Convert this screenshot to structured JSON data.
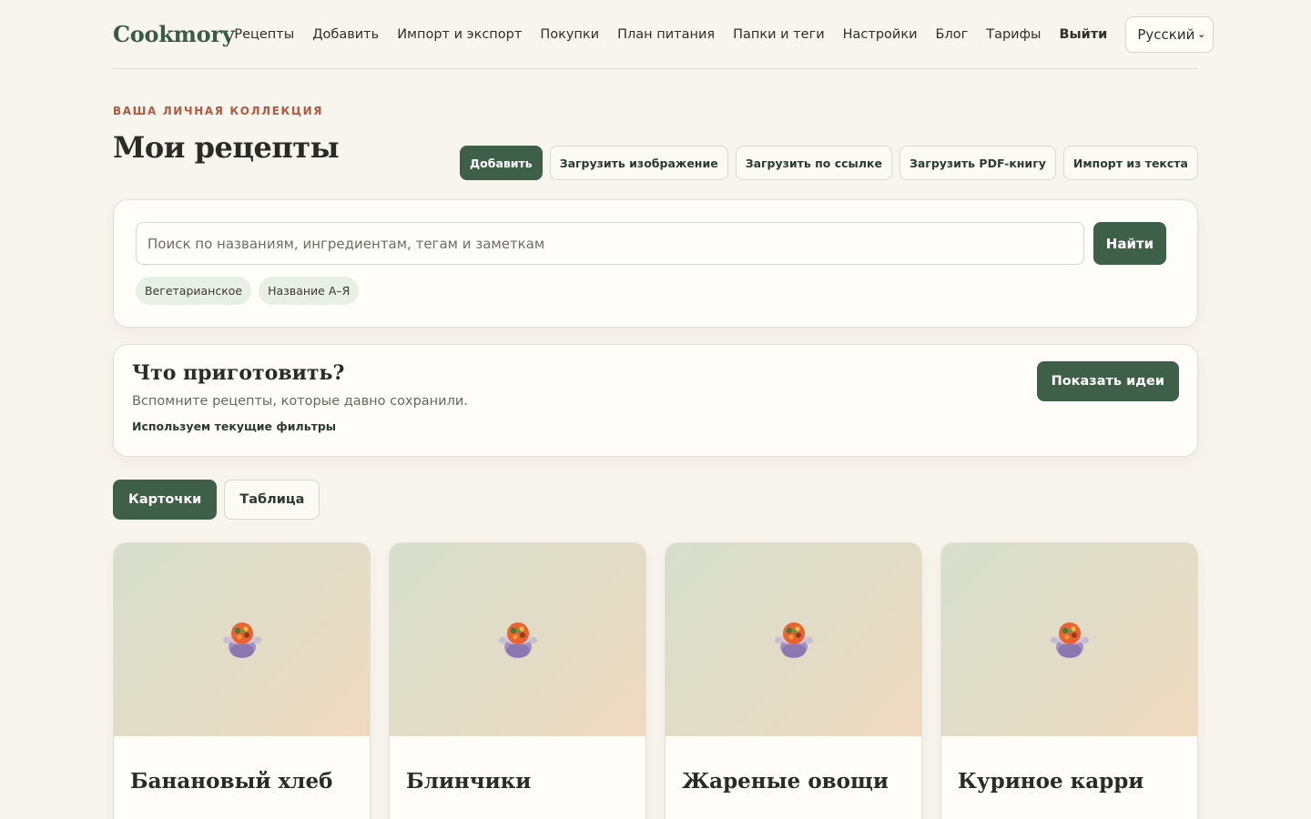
{
  "header": {
    "logo": "Cookmory",
    "nav": [
      "Рецепты",
      "Добавить",
      "Импорт и экспорт",
      "Покупки",
      "План питания",
      "Папки и теги",
      "Настройки",
      "Блог",
      "Тарифы"
    ],
    "logout": "Выйти",
    "language": "Русский"
  },
  "hero": {
    "eyebrow": "ВАША ЛИЧНАЯ КОЛЛЕКЦИЯ",
    "title": "Мои рецепты",
    "actions": [
      "Добавить",
      "Загрузить изображение",
      "Загрузить по ссылке",
      "Загрузить PDF-книгу",
      "Импорт из текста"
    ]
  },
  "search": {
    "placeholder": "Поиск по названиям, ингредиентам, тегам и заметкам",
    "button": "Найти",
    "chips": [
      "Вегетарианское",
      "Название А–Я"
    ]
  },
  "idea": {
    "title": "Что приготовить?",
    "subtitle": "Вспомните рецепты, которые давно сохранили.",
    "note": "Используем текущие фильтры",
    "button": "Показать идеи"
  },
  "view": {
    "options": [
      "Карточки",
      "Таблица"
    ],
    "active": "Карточки"
  },
  "recipes": [
    {
      "name": "Банановый хлеб",
      "icon": "stew-pot-icon"
    },
    {
      "name": "Блинчики",
      "icon": "stew-pot-icon"
    },
    {
      "name": "Жареные овощи",
      "icon": "stew-pot-icon"
    },
    {
      "name": "Куриное карри",
      "icon": "stew-pot-icon"
    }
  ],
  "colors": {
    "accent": "#3e5f48",
    "eyebrow": "#b4573a",
    "background": "#f8f5ee"
  }
}
